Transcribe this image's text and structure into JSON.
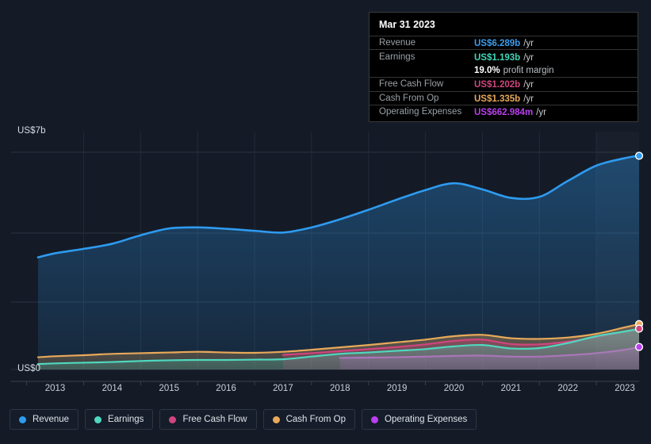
{
  "chart_data": {
    "type": "area",
    "title": "",
    "xlabel": "",
    "ylabel": "",
    "currency": "US$",
    "ylim": [
      0,
      7
    ],
    "y_ticks": [
      {
        "label": "US$0",
        "value": 0
      },
      {
        "label": "US$7b",
        "value": 7
      }
    ],
    "grid": true,
    "legend_position": "bottom",
    "x_tick_labels": [
      "2013",
      "2014",
      "2015",
      "2016",
      "2017",
      "2018",
      "2019",
      "2020",
      "2021",
      "2022",
      "2023"
    ],
    "x": [
      2012.7,
      2013,
      2013.5,
      2014,
      2014.5,
      2015,
      2015.5,
      2016,
      2016.5,
      2017,
      2017.5,
      2018,
      2018.5,
      2019,
      2019.5,
      2020,
      2020.5,
      2021,
      2021.5,
      2022,
      2022.5,
      2023,
      2023.25
    ],
    "series": [
      {
        "name": "Revenue",
        "color": "#2e9bf0",
        "values": [
          3.3,
          3.42,
          3.55,
          3.7,
          3.95,
          4.15,
          4.18,
          4.14,
          4.08,
          4.03,
          4.18,
          4.42,
          4.7,
          5.0,
          5.28,
          5.48,
          5.3,
          5.05,
          5.08,
          5.55,
          6.0,
          6.22,
          6.289
        ]
      },
      {
        "name": "Earnings",
        "color": "#4fd8bf",
        "values": [
          0.16,
          0.18,
          0.2,
          0.22,
          0.25,
          0.27,
          0.28,
          0.28,
          0.29,
          0.3,
          0.38,
          0.46,
          0.5,
          0.55,
          0.6,
          0.68,
          0.72,
          0.62,
          0.63,
          0.78,
          0.98,
          1.12,
          1.193
        ]
      },
      {
        "name": "Free Cash Flow",
        "color": "#d1457e",
        "values": [
          null,
          null,
          null,
          null,
          null,
          null,
          null,
          null,
          null,
          0.43,
          0.48,
          0.54,
          0.6,
          0.66,
          0.74,
          0.84,
          0.88,
          0.75,
          0.74,
          0.82,
          0.96,
          1.12,
          1.202
        ]
      },
      {
        "name": "Cash From Op",
        "color": "#e8a95a",
        "values": [
          0.36,
          0.39,
          0.42,
          0.46,
          0.48,
          0.5,
          0.52,
          0.5,
          0.49,
          0.52,
          0.58,
          0.65,
          0.72,
          0.8,
          0.88,
          0.98,
          1.02,
          0.92,
          0.9,
          0.94,
          1.05,
          1.24,
          1.335
        ]
      },
      {
        "name": "Operating Expenses",
        "color": "#bb3ff0",
        "values": [
          null,
          null,
          null,
          null,
          null,
          null,
          null,
          null,
          null,
          null,
          null,
          0.34,
          0.35,
          0.36,
          0.38,
          0.4,
          0.41,
          0.38,
          0.38,
          0.42,
          0.48,
          0.58,
          0.662984
        ]
      }
    ],
    "endpoints": [
      {
        "name": "Revenue",
        "color": "#2e9bf0"
      },
      {
        "name": "Cash From Op",
        "color": "#e8a95a"
      },
      {
        "name": "Free Cash Flow",
        "color": "#d1457e"
      },
      {
        "name": "Operating Expenses",
        "color": "#bb3ff0"
      }
    ]
  },
  "tooltip": {
    "date": "Mar 31 2023",
    "rows": [
      {
        "key": "Revenue",
        "value": "US$6.289b",
        "unit": "/yr",
        "color": "#3c9ef0",
        "rule": true
      },
      {
        "key": "Earnings",
        "value": "US$1.193b",
        "unit": "/yr",
        "color": "#3fd8b8",
        "rule": true
      },
      {
        "key": "",
        "value": "19.0%",
        "sub": "profit margin",
        "color": "#ffffff",
        "rule": false
      },
      {
        "key": "Free Cash Flow",
        "value": "US$1.202b",
        "unit": "/yr",
        "color": "#d1457e",
        "rule": true
      },
      {
        "key": "Cash From Op",
        "value": "US$1.335b",
        "unit": "/yr",
        "color": "#e8a95a",
        "rule": true
      },
      {
        "key": "Operating Expenses",
        "value": "US$662.984m",
        "unit": "/yr",
        "color": "#bb3ff0",
        "rule": true
      }
    ]
  },
  "legend": {
    "items": [
      {
        "label": "Revenue",
        "color": "#2e9bf0"
      },
      {
        "label": "Earnings",
        "color": "#4fd8bf"
      },
      {
        "label": "Free Cash Flow",
        "color": "#d1457e"
      },
      {
        "label": "Cash From Op",
        "color": "#e8a95a"
      },
      {
        "label": "Operating Expenses",
        "color": "#bb3ff0"
      }
    ]
  }
}
